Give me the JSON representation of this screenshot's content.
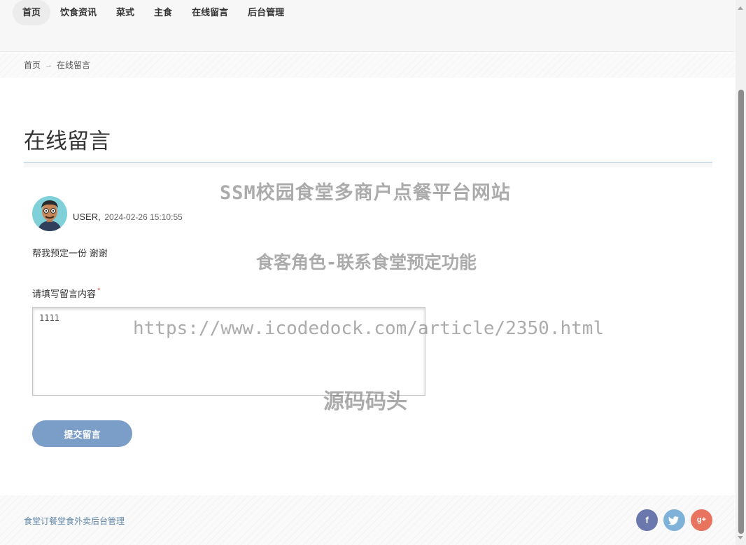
{
  "nav": {
    "items": [
      {
        "label": "首页",
        "active": true
      },
      {
        "label": "饮食资讯",
        "active": false
      },
      {
        "label": "菜式",
        "active": false
      },
      {
        "label": "主食",
        "active": false
      },
      {
        "label": "在线留言",
        "active": false
      },
      {
        "label": "后台管理",
        "active": false
      }
    ]
  },
  "breadcrumb": {
    "home": "首页",
    "arrow": "→",
    "current": "在线留言"
  },
  "page": {
    "title": "在线留言"
  },
  "message": {
    "user": "USER,",
    "time": "2024-02-26 15:10:55",
    "content": "帮我预定一份 谢谢"
  },
  "form": {
    "label": "请填写留言内容",
    "required_mark": "*",
    "value": "1111",
    "submit_label": "提交留言"
  },
  "watermarks": {
    "line1": "SSM校园食堂多商户点餐平台网站",
    "line2": "食客角色-联系食堂预定功能",
    "line3": "https://www.icodedock.com/article/2350.html",
    "line4": "源码码头"
  },
  "footer": {
    "link": "食堂订餐堂食外卖后台管理",
    "social": {
      "facebook": "f",
      "twitter": "t",
      "google": "g+"
    }
  },
  "colors": {
    "accent": "#7b9ec8",
    "rule": "#a9c6dc",
    "facebook": "#6a78ad",
    "twitter": "#7fb2d8",
    "google": "#e8735f"
  }
}
